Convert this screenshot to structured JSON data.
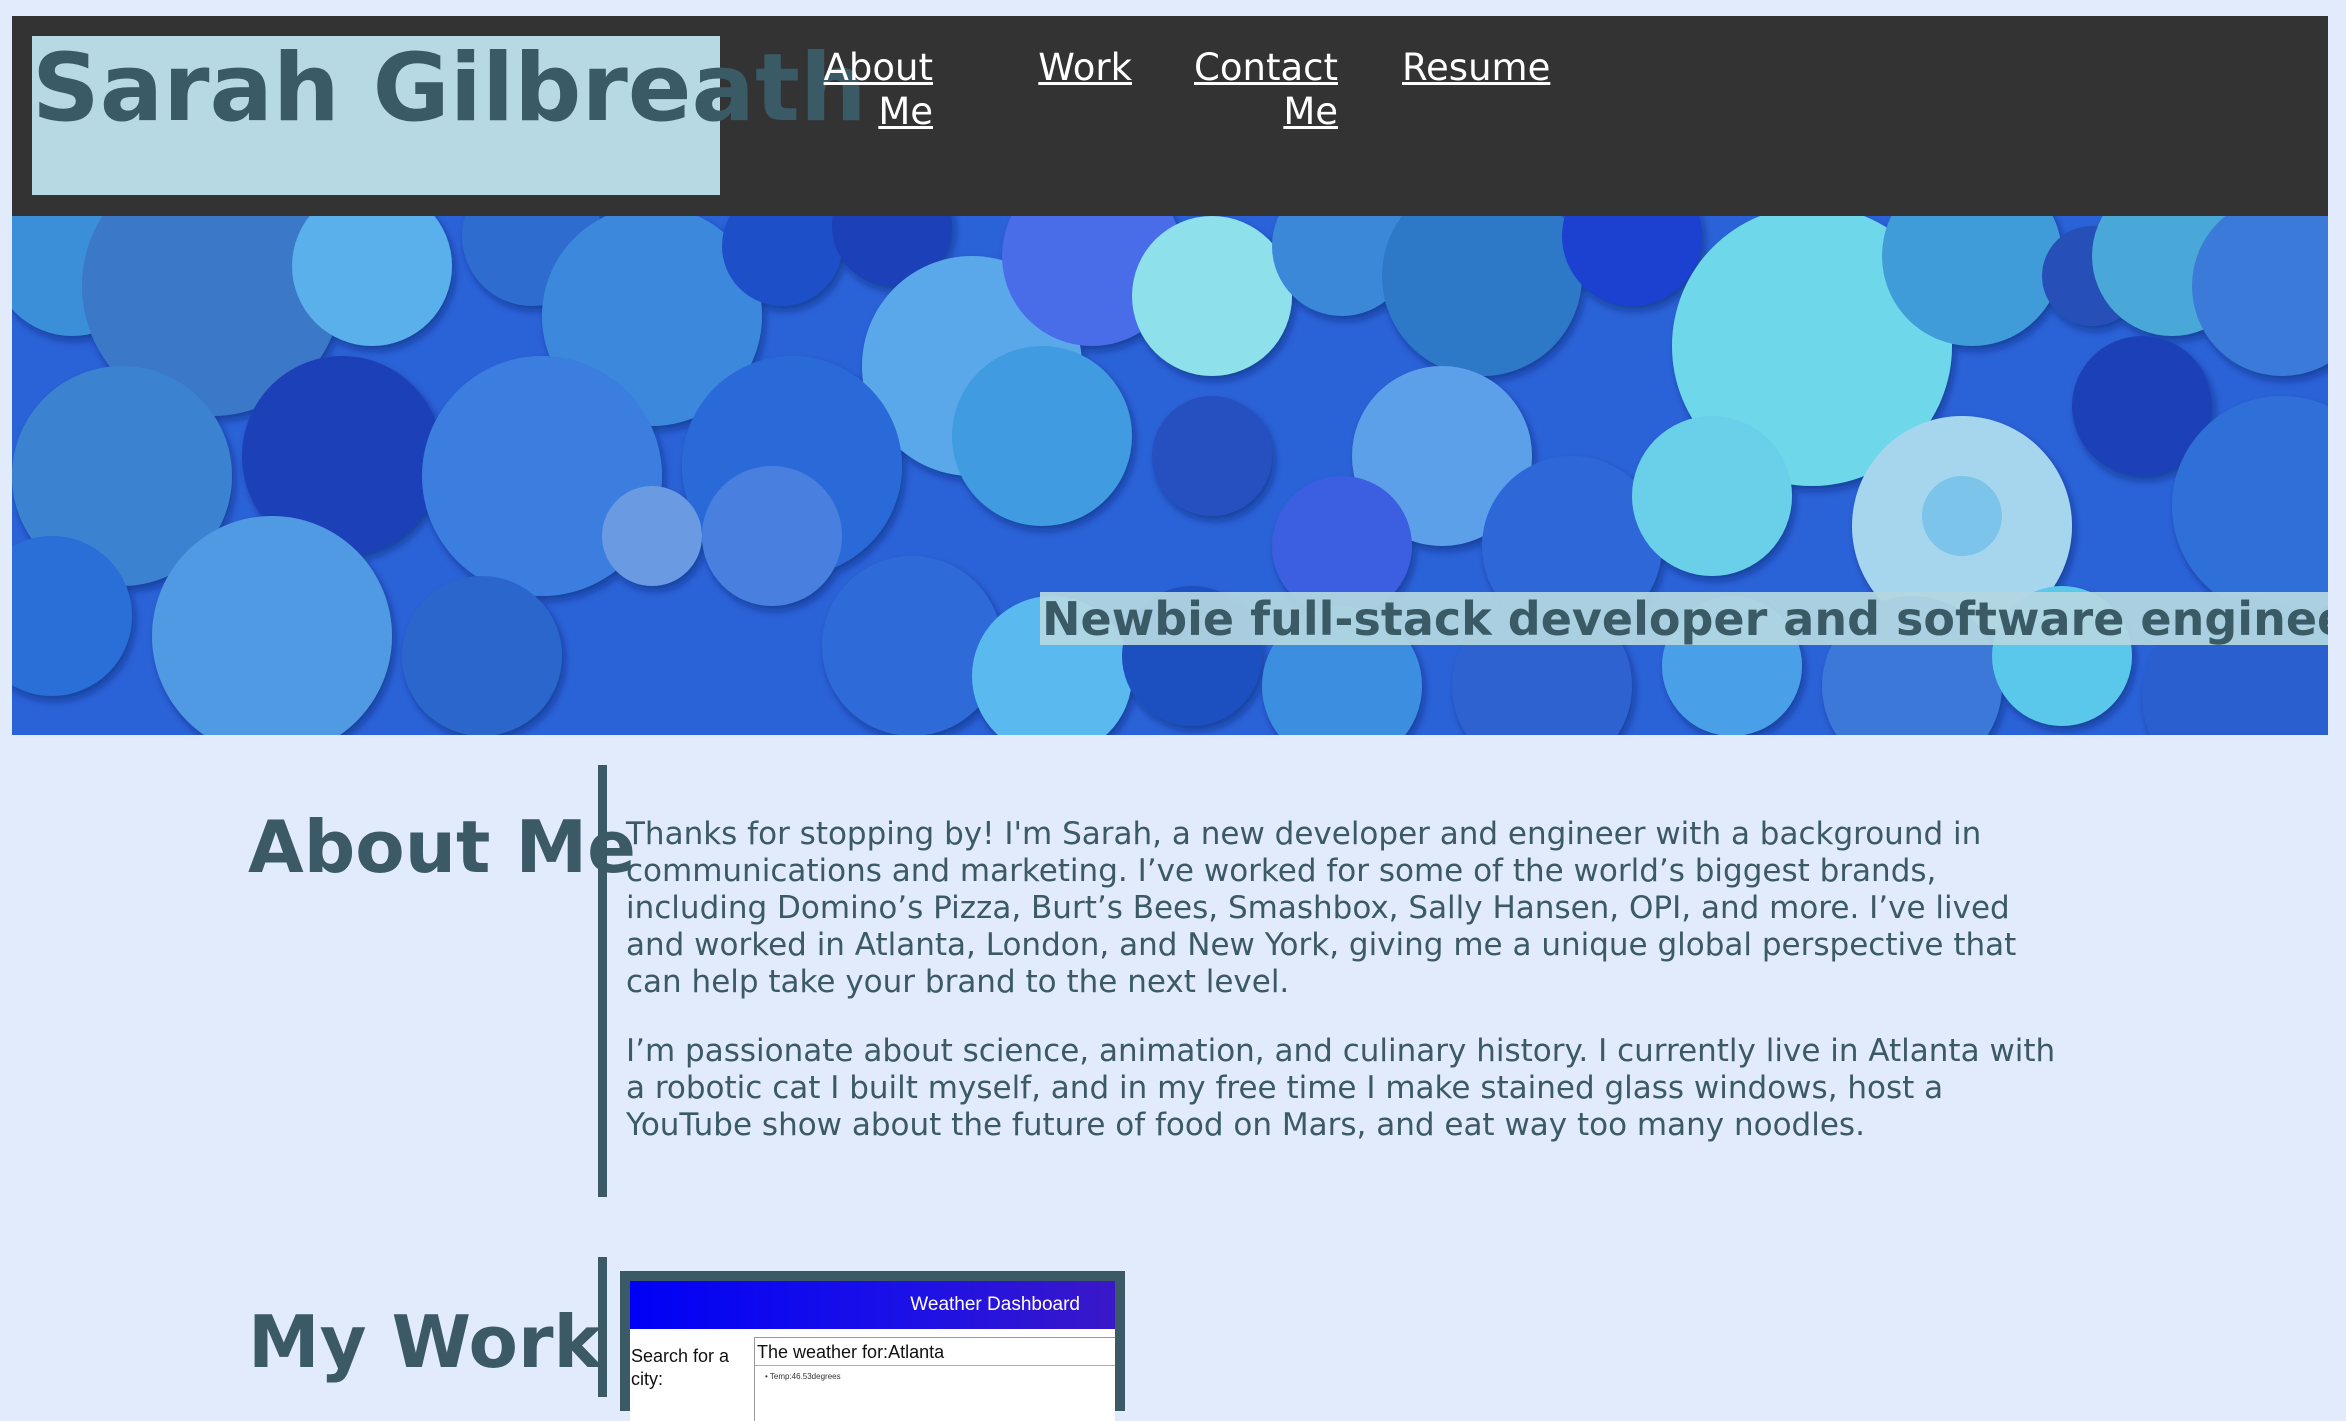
{
  "header": {
    "name": "Sarah Gilbreath",
    "nav": {
      "about_line1": "About",
      "about_line2": "Me",
      "work": "Work",
      "contact_line1": "Contact",
      "contact_line2": "Me",
      "resume": "Resume"
    }
  },
  "hero": {
    "tagline": "Newbie full-stack developer and software engineer"
  },
  "about": {
    "heading": "About Me",
    "paragraphs": [
      "Thanks for stopping by! I'm Sarah, a new developer and engineer with a background in communications and marketing. I’ve worked for some of the world’s biggest brands, including Domino’s Pizza, Burt’s Bees, Smashbox, Sally Hansen, OPI, and more. I’ve lived and worked in Atlanta, London, and New York, giving me a unique global perspective that can help take your brand to the next level.",
      "I’m passionate about science, animation, and culinary history. I currently live in Atlanta with a robotic cat I built myself, and in my free time I make stained glass windows, host a YouTube show about the future of food on Mars, and eat way too many noodles."
    ]
  },
  "work": {
    "heading": "My Work",
    "project": {
      "title": "Weather Dashboard",
      "search_label": "Search for a city:",
      "result_title": "The weather for:Atlanta",
      "temp": "• Temp:46.53degrees"
    }
  },
  "colors": {
    "page_bg": "#e1ebfb",
    "header_bg": "#333333",
    "accent_box": "#b7d9e3",
    "text_dark": "#3b5a66",
    "nav_text": "#ffffff"
  }
}
